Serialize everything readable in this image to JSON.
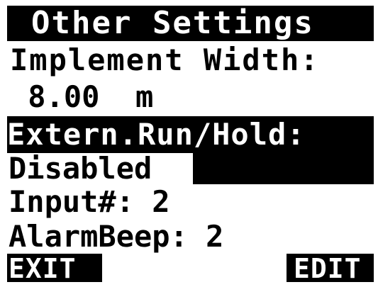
{
  "screen": {
    "title": "Other Settings",
    "implement_width_label": "Implement Width:",
    "implement_width_value": " 8.00  m",
    "extern_run_hold_label": "Extern.Run/Hold:",
    "extern_run_hold_value": "Disabled",
    "input_number": "Input#: 2",
    "alarm_beep": "AlarmBeep: 2"
  },
  "softkeys": {
    "left_label": "EXIT",
    "right_label": "EDIT"
  },
  "colors": {
    "foreground": "#000000",
    "background": "#ffffff"
  }
}
